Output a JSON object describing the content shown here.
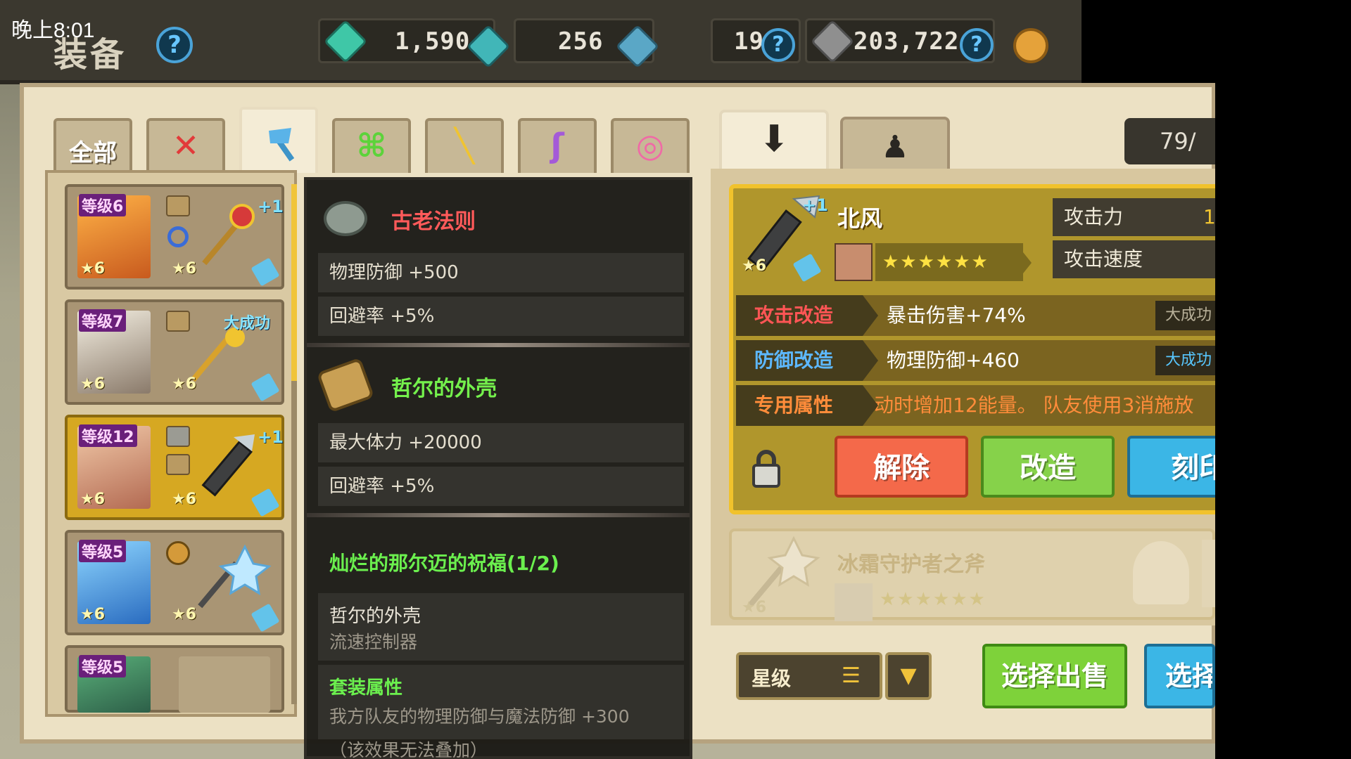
{
  "status_bar": {
    "time": "晚上8:01"
  },
  "header": {
    "title": "装备",
    "resources": [
      {
        "name": "green-crystal",
        "value": "1,590",
        "color": "#3fc7a7"
      },
      {
        "name": "teal-gem",
        "value": "256",
        "color": "#41b6b8"
      },
      {
        "name": "blue-stone",
        "value": "19",
        "color": "#5aa7c6"
      },
      {
        "name": "silver-ore",
        "value": "203,722",
        "color": "#8f8f8f"
      }
    ]
  },
  "category_tabs": [
    {
      "label": "全部",
      "icon": "all"
    },
    {
      "label": "",
      "icon": "sword-icon"
    },
    {
      "label": "",
      "icon": "axe-icon"
    },
    {
      "label": "",
      "icon": "bow-icon"
    },
    {
      "label": "",
      "icon": "rifle-icon"
    },
    {
      "label": "",
      "icon": "staff-icon"
    },
    {
      "label": "",
      "icon": "ring-icon"
    }
  ],
  "right_tabs": [
    {
      "icon": "weapon-icon"
    },
    {
      "icon": "accessory-icon"
    }
  ],
  "inventory_count": "79/",
  "inventory": [
    {
      "level": "等级6",
      "hero_stars": "6",
      "weapon_stars": "6",
      "plus": "+1",
      "tag": ""
    },
    {
      "level": "等级7",
      "hero_stars": "6",
      "weapon_stars": "6",
      "plus": "",
      "tag": "大成功"
    },
    {
      "level": "等级12",
      "hero_stars": "6",
      "weapon_stars": "6",
      "plus": "+1",
      "tag": ""
    },
    {
      "level": "等级5",
      "hero_stars": "6",
      "weapon_stars": "6",
      "plus": "",
      "tag": ""
    },
    {
      "level": "等级5",
      "hero_stars": "",
      "weapon_stars": "",
      "plus": "",
      "tag": ""
    }
  ],
  "tooltip": {
    "item1": {
      "name": "古老法则",
      "stats": [
        "物理防御 +500",
        "回避率 +5%"
      ]
    },
    "item2": {
      "name": "哲尔的外壳",
      "stats": [
        "最大体力 +20000",
        "回避率 +5%"
      ]
    },
    "set_title": "灿烂的那尔迈的祝福(1/2)",
    "set_members": [
      "哲尔的外壳",
      "流速控制器"
    ],
    "set_attr_label": "套装属性",
    "set_attr": "我方队友的物理防御与魔法防御 +300",
    "set_note": "（该效果无法叠加）"
  },
  "detail": {
    "weapon_name": "北风",
    "plus": "+1",
    "weapon_stars": "6",
    "stars": "★★★★★★",
    "stats": [
      "攻击力",
      "攻击速度"
    ],
    "attack_value": "1",
    "mods": [
      {
        "label": "攻击改造",
        "value": "暴击伤害+74%",
        "tag": "大成功",
        "label_color": "#ff5555",
        "tag_color": "#b9b19a"
      },
      {
        "label": "防御改造",
        "value": "物理防御+460",
        "tag": "大成功",
        "label_color": "#5db8ff",
        "tag_color": "#58c7ff"
      },
      {
        "label": "专用属性",
        "value": "动时增加12能量。 队友使用3消施放",
        "tag": "",
        "label_color": "#ff8c3a",
        "tag_color": ""
      }
    ],
    "buttons": {
      "release": "解除",
      "modify": "改造",
      "engrave": "刻印"
    }
  },
  "next_item": {
    "name": "冰霜守护者之斧",
    "stars": "★★★★★★",
    "weapon_stars": "6"
  },
  "bottom": {
    "sort_label": "星级",
    "sell_button": "选择出售",
    "select_button": "选择"
  }
}
